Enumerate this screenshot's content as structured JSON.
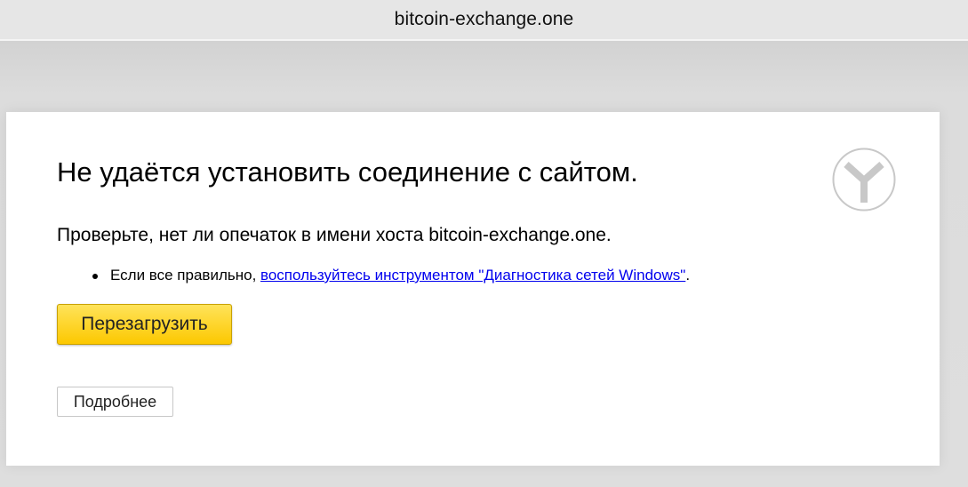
{
  "address_bar": {
    "host": "bitcoin-exchange.one"
  },
  "error_page": {
    "title": "Не удаётся установить соединение с сайтом.",
    "subtitle": "Проверьте, нет ли опечаток в имени хоста bitcoin-exchange.one.",
    "tip_prefix": "Если все правильно, ",
    "tip_link": "воспользуйтесь инструментом \"Диагностика сетей Windows\"",
    "tip_suffix": ".",
    "reload_label": "Перезагрузить",
    "details_label": "Подробнее",
    "logo_icon": "yandex-browser-logo-icon"
  },
  "colors": {
    "reload_button": "#fcc800",
    "link": "#0000ee",
    "logo_stroke": "#c8c8c8"
  }
}
